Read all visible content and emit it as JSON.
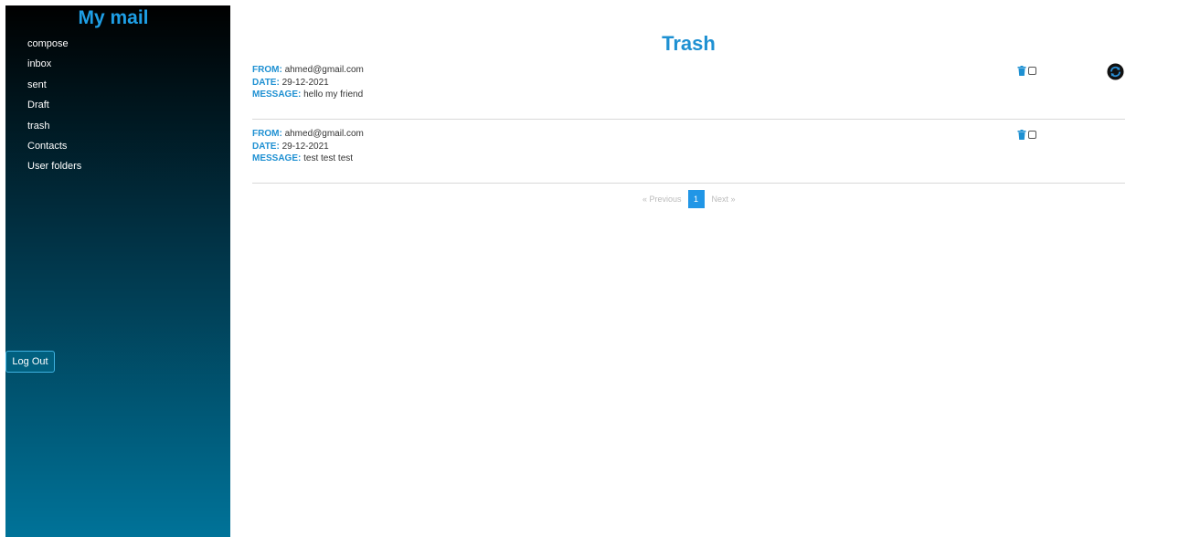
{
  "app": {
    "brand": "My mail"
  },
  "sidebar": {
    "items": [
      {
        "label": "compose"
      },
      {
        "label": "inbox"
      },
      {
        "label": "sent"
      },
      {
        "label": "Draft"
      },
      {
        "label": "trash"
      },
      {
        "label": "Contacts"
      },
      {
        "label": "User folders"
      }
    ],
    "logout_label": "Log Out"
  },
  "main": {
    "title": "Trash",
    "labels": {
      "from": "FROM:",
      "date": "DATE:",
      "message": "MESSAGE:"
    },
    "messages": [
      {
        "from": "ahmed@gmail.com",
        "date": "29-12-2021",
        "message": "hello my friend"
      },
      {
        "from": "ahmed@gmail.com",
        "date": "29-12-2021",
        "message": "test test test"
      }
    ],
    "pagination": {
      "previous": "« Previous",
      "current": "1",
      "next": "Next »"
    }
  },
  "icons": {
    "trash": "trash-icon",
    "refresh": "refresh-icon",
    "checkbox": "checkbox-icon"
  },
  "colors": {
    "accent": "#1e90d2",
    "brand": "#1e9fe6",
    "sidebar_top": "#000000",
    "sidebar_bottom": "#007399",
    "pagination_active": "#2196e6"
  }
}
